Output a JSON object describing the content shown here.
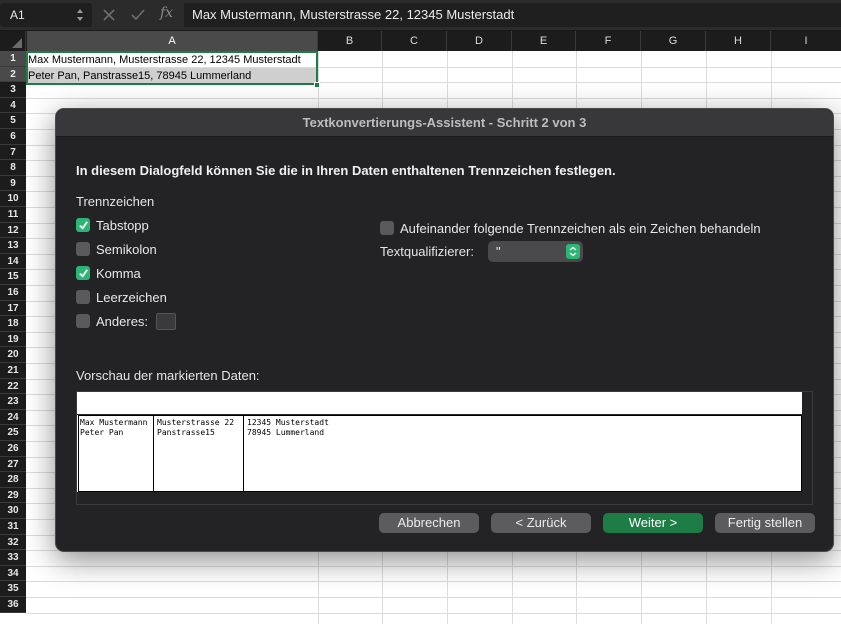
{
  "formula_bar": {
    "name_box": "A1",
    "cancel_icon": "close-icon",
    "confirm_icon": "checkmark-icon",
    "fx_label": "fx",
    "content": "Max Mustermann, Musterstrasse 22, 12345 Musterstadt"
  },
  "sheet": {
    "columns": [
      "A",
      "B",
      "C",
      "D",
      "E",
      "F",
      "G",
      "H",
      "I"
    ],
    "rows": [
      "1",
      "2",
      "3",
      "4",
      "5",
      "6",
      "7",
      "8",
      "9",
      "10",
      "11",
      "12",
      "13",
      "14",
      "15",
      "16",
      "17",
      "18",
      "19",
      "20",
      "21",
      "22",
      "23",
      "24",
      "25",
      "26",
      "27",
      "28",
      "29",
      "30",
      "31",
      "32",
      "33",
      "34",
      "35",
      "36"
    ],
    "cells": {
      "A1": "Max Mustermann, Musterstrasse 22, 12345 Musterstadt",
      "A2": "Peter Pan, Panstrasse15, 78945 Lummerland"
    }
  },
  "dialog": {
    "title": "Textkonvertierungs-Assistent - Schritt 2 von 3",
    "heading": "In diesem Dialogfeld können Sie die in Ihren Daten enthaltenen Trennzeichen festlegen.",
    "delimiters_label": "Trennzeichen",
    "delimiters": [
      {
        "label": "Tabstopp",
        "checked": true
      },
      {
        "label": "Semikolon",
        "checked": false
      },
      {
        "label": "Komma",
        "checked": true
      },
      {
        "label": "Leerzeichen",
        "checked": false
      },
      {
        "label": "Anderes:",
        "checked": false
      }
    ],
    "consecutive_label": "Aufeinander folgende Trennzeichen als ein Zeichen behandeln",
    "consecutive_checked": false,
    "qualifier_label": "Textqualifizierer:",
    "qualifier_value": "\"",
    "preview_label": "Vorschau der markierten Daten:",
    "preview_columns": [
      [
        "Max Mustermann",
        "Peter Pan"
      ],
      [
        "Musterstrasse 22",
        "Panstrasse15"
      ],
      [
        "12345 Musterstadt",
        "78945 Lummerland"
      ]
    ],
    "buttons": {
      "cancel": "Abbrechen",
      "back": "< Zurück",
      "next": "Weiter >",
      "finish": "Fertig stellen"
    }
  },
  "colors": {
    "accent_green": "#1e7d45",
    "checkbox_green": "#2bb673",
    "dialog_bg": "#232325"
  }
}
